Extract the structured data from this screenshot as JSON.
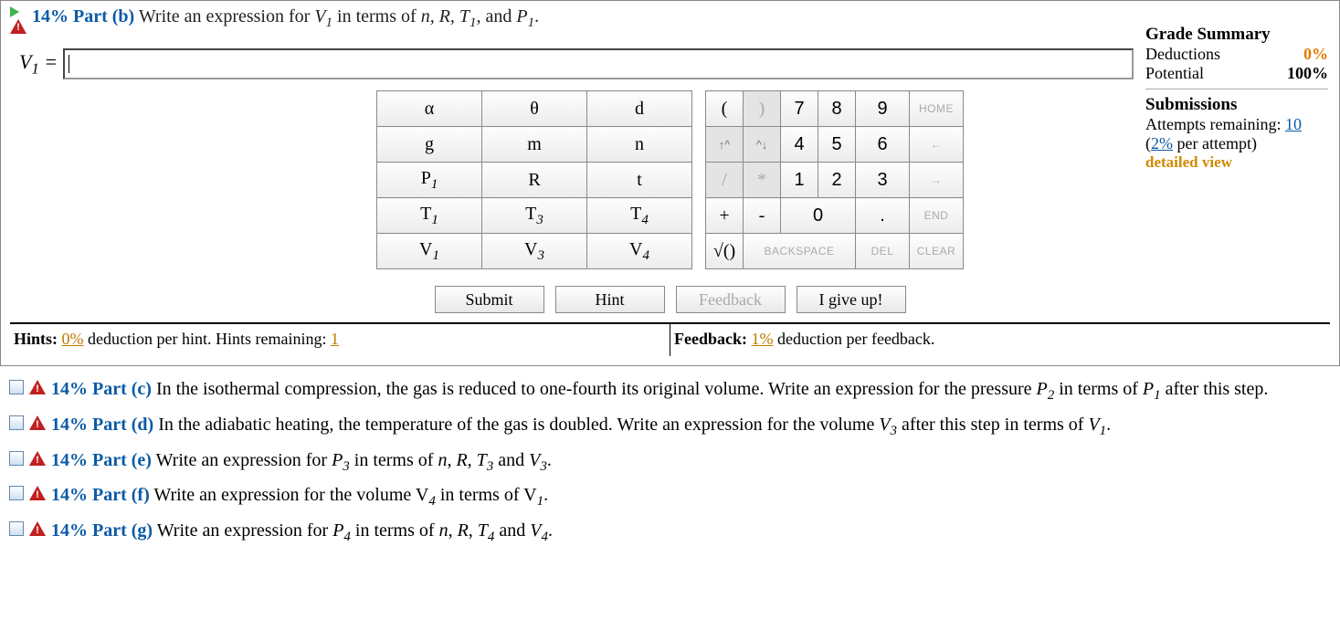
{
  "part_b": {
    "label": "14% Part (b)",
    "text_pre": "  Write an expression for ",
    "text_var": "V",
    "text_sub": "1",
    "text_mid": " in terms of ",
    "terms": "n, R, T",
    "terms_sub": "1",
    "terms_mid2": ", and ",
    "terms2": "P",
    "terms2_sub": "1",
    "text_end": "."
  },
  "answer": {
    "lhs_var": "V",
    "lhs_sub": "1",
    "lhs_eq": " = "
  },
  "grade_summary": {
    "title": "Grade Summary",
    "deductions_label": "Deductions",
    "deductions_val": "0%",
    "potential_label": "Potential",
    "potential_val": "100%"
  },
  "submissions": {
    "title": "Submissions",
    "attempts_label_pre": "Attempts remaining: ",
    "attempts_val": "10",
    "penalty_pre": "(",
    "penalty_link": "2%",
    "penalty_post": " per attempt)",
    "detailed": "detailed view"
  },
  "var_pad": {
    "r0": [
      "α",
      "θ",
      "d"
    ],
    "r1": [
      "g",
      "m",
      "n"
    ],
    "r2_html": [
      "P<sub>1</sub>",
      "R",
      "t"
    ],
    "r3_html": [
      "T<sub>1</sub>",
      "T<sub>3</sub>",
      "T<sub>4</sub>"
    ],
    "r4_html": [
      "V<sub>1</sub>",
      "V<sub>3</sub>",
      "V<sub>4</sub>"
    ]
  },
  "num_pad": {
    "row0": {
      "a": "(",
      "b": ")",
      "c": "7",
      "d": "8",
      "e": "9",
      "f": "HOME"
    },
    "row1": {
      "a": "↑^",
      "b": "^↓",
      "c": "4",
      "d": "5",
      "e": "6",
      "f": "←"
    },
    "row2": {
      "a": "/",
      "b": "*",
      "c": "1",
      "d": "2",
      "e": "3",
      "f": "→"
    },
    "row3": {
      "a": "+",
      "b": "-",
      "c": "0",
      "d": ".",
      "e": "END"
    },
    "row4": {
      "a": "√()",
      "b": "BACKSPACE",
      "c": "DEL",
      "d": "CLEAR"
    }
  },
  "actions": {
    "submit": "Submit",
    "hint": "Hint",
    "feedback": "Feedback",
    "giveup": "I give up!"
  },
  "footer": {
    "hints_label": "Hints: ",
    "hints_pct": "0%",
    "hints_mid": " deduction per hint. Hints remaining: ",
    "hints_remain": "1",
    "feedback_label": "Feedback: ",
    "feedback_pct": "1%",
    "feedback_mid": " deduction per feedback."
  },
  "parts": {
    "c_label": "14% Part (c)",
    "c_text_html": "  In the isothermal compression, the gas is reduced to one-fourth its original volume. Write an expression for the pressure <span class='italic'>P</span><sub>2</sub> in terms of <span class='italic'>P</span><sub>1</sub> after this step.",
    "d_label": "14% Part (d)",
    "d_text_html": "  In the adiabatic heating, the temperature of the gas is doubled. Write an expression for the volume <span class='italic'>V</span><sub>3</sub> after this step in terms of <span class='italic'>V</span><sub>1</sub>.",
    "e_label": "14% Part (e)",
    "e_text_html": "  Write an expression for <span class='italic'>P</span><sub>3</sub> in terms of <span class='italic'>n</span>, <span class='italic'>R</span>, <span class='italic'>T</span><sub>3</sub> and <span class='italic'>V</span><sub>3</sub>.",
    "f_label": "14% Part (f)",
    "f_text_html": "  Write an expression for the volume V<sub>4</sub> in terms of V<sub>1</sub>.",
    "g_label": "14% Part (g)",
    "g_text_html": "  Write an expression for <span class='italic'>P</span><sub>4</sub> in terms of <span class='italic'>n</span>, <span class='italic'>R</span>, <span class='italic'>T</span><sub>4</sub> and <span class='italic'>V</span><sub>4</sub>."
  }
}
